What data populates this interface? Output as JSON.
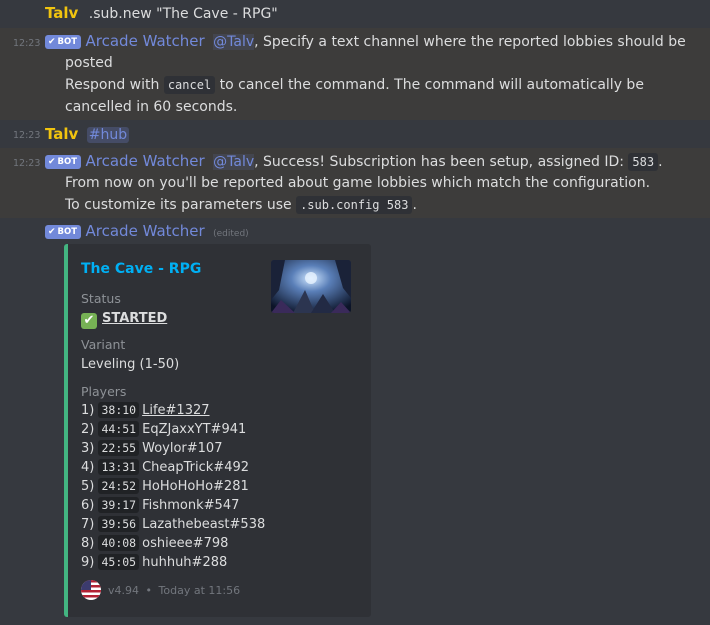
{
  "messages": [
    {
      "author": "Talv",
      "text": ".sub.new \"The Cave - RPG\""
    },
    {
      "time": "12:23",
      "bot_label": "BOT",
      "author": "Arcade Watcher",
      "mention": "@Talv",
      "line1": ", Specify a text channel where the reported lobbies should be",
      "line2": "posted",
      "line3_pre": "Respond with",
      "code": "cancel",
      "line3_post": "to cancel the command. The command will automatically be",
      "line4": "cancelled in 60 seconds."
    },
    {
      "time": "12:23",
      "author": "Talv",
      "channel": "#hub"
    },
    {
      "time": "12:23",
      "bot_label": "BOT",
      "author": "Arcade Watcher",
      "mention": "@Talv",
      "line1": ", Success! Subscription has been setup, assigned ID:",
      "id_code": "583",
      "period": ".",
      "line2": "From now on you'll be reported about game lobbies which match the configuration.",
      "line3": "To customize its parameters use",
      "config_code": ".sub.config 583",
      "period2": "."
    },
    {
      "bot_label": "BOT",
      "author": "Arcade Watcher",
      "edited": "(edited)"
    }
  ],
  "embed": {
    "accent": "#43b581",
    "title": "The Cave - RPG",
    "status_label": "Status",
    "status_icon": "✔",
    "status_value": "STARTED",
    "variant_label": "Variant",
    "variant_value": "Leveling (1-50)",
    "players_label": "Players",
    "players": [
      {
        "n": "1)",
        "time": "38:10",
        "name": "Life#1327"
      },
      {
        "n": "2)",
        "time": "44:51",
        "name": "EqZJaxxYT#941"
      },
      {
        "n": "3)",
        "time": "22:55",
        "name": "Woylor#107"
      },
      {
        "n": "4)",
        "time": "13:31",
        "name": "CheapTrick#492"
      },
      {
        "n": "5)",
        "time": "24:52",
        "name": "HoHoHoHo#281"
      },
      {
        "n": "6)",
        "time": "39:17",
        "name": "Fishmonk#547"
      },
      {
        "n": "7)",
        "time": "39:56",
        "name": "Lazathebeast#538"
      },
      {
        "n": "8)",
        "time": "40:08",
        "name": "oshieee#798"
      },
      {
        "n": "9)",
        "time": "45:05",
        "name": "huhhuh#288"
      }
    ],
    "footer_version": "v4.94",
    "footer_sep": "•",
    "footer_time": "Today at 11:56"
  }
}
